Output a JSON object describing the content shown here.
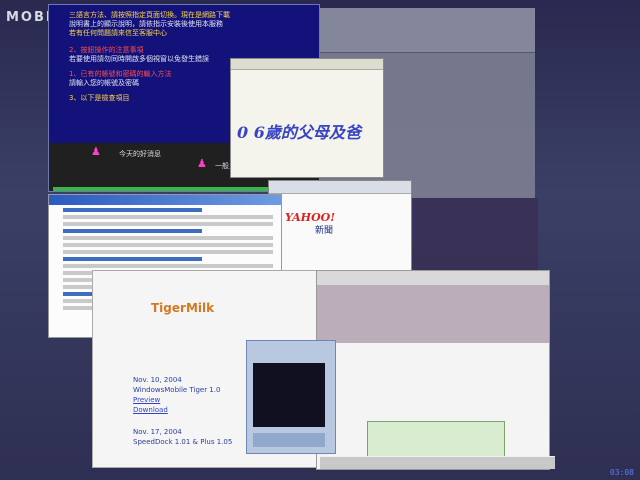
{
  "watermark": {
    "text": "MOBILE",
    "logo_text": "01"
  },
  "winA": {
    "lines": [
      "三語言方法、請按照指定頁面切換。現在是網路下載",
      "說明書上的顯示說明，請依指示安裝後使用本服務",
      "若有任何問題請來信至客服中心",
      "2、按鈕操作的注意事項",
      "若要使用請勿同時開啟多個視窗以免發生錯誤",
      "1、已有的帳號和密碼的輸入方法",
      "請輸入您的帳號及密碼",
      "3、以下是檢查項目"
    ],
    "highlight": "0 6歲的父母",
    "bottom_left": "今天的好消息",
    "bottom_right": "一般三歲，我們喜歡小孩"
  },
  "winB": {
    "calligraphy": "0 6歲的父母及爸"
  },
  "winC": {
    "brand": "YAHOO!",
    "section": "新聞"
  },
  "winE": {
    "brand": "TigerMilk",
    "line1": "Nov. 10, 2004",
    "line2": "WindowsMobile Tiger 1.0",
    "link1": "Preview",
    "link2": "Download",
    "line3": "Nov. 17, 2004",
    "line4": "SpeedDock 1.01 & Plus 1.05"
  },
  "clock": "03:08"
}
